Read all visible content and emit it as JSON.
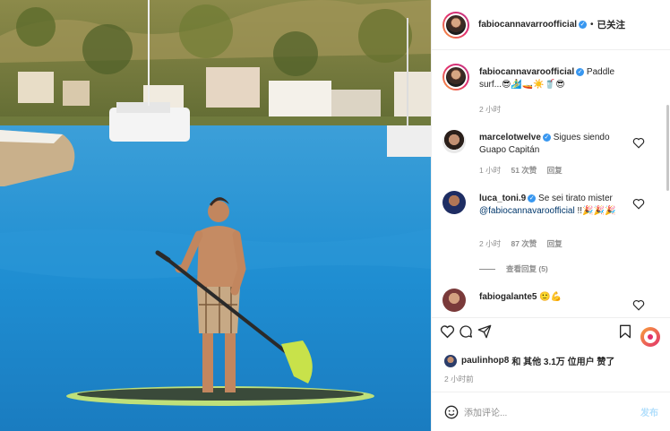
{
  "header": {
    "username": "fabiocannavarroofficial",
    "follow_label": "已关注"
  },
  "caption": {
    "username": "fabiocannavaroofficial",
    "text": "Paddle surf...😎🏄‍♂️🚤☀️🥤😎",
    "time": "2 小时"
  },
  "comments": [
    {
      "username": "marcelotwelve",
      "text": "Sigues siendo Guapo Capitán",
      "time": "1 小时",
      "likes": "51 次赞",
      "reply": "回复"
    },
    {
      "username": "luca_toni.9",
      "text": "Se sei tirato mister",
      "mention": "@fabiocannavaroofficial",
      "emoji": "!!🎉🎉🎉",
      "time": "2 小时",
      "likes": "87 次赞",
      "reply": "回复",
      "view_replies": "查看回复 (5)"
    },
    {
      "username": "fabiogalante5",
      "text": "🙂💪"
    }
  ],
  "likes_line": {
    "user": "paulinhop8",
    "rest": "和 其他 3.1万 位用户 赞了"
  },
  "post_time": "2 小时前",
  "add_comment": {
    "placeholder": "添加评论...",
    "post_label": "发布"
  },
  "icons": [
    "verified-badge-icon",
    "heart-icon",
    "comment-icon",
    "share-icon",
    "bookmark-icon",
    "emoji-icon"
  ]
}
